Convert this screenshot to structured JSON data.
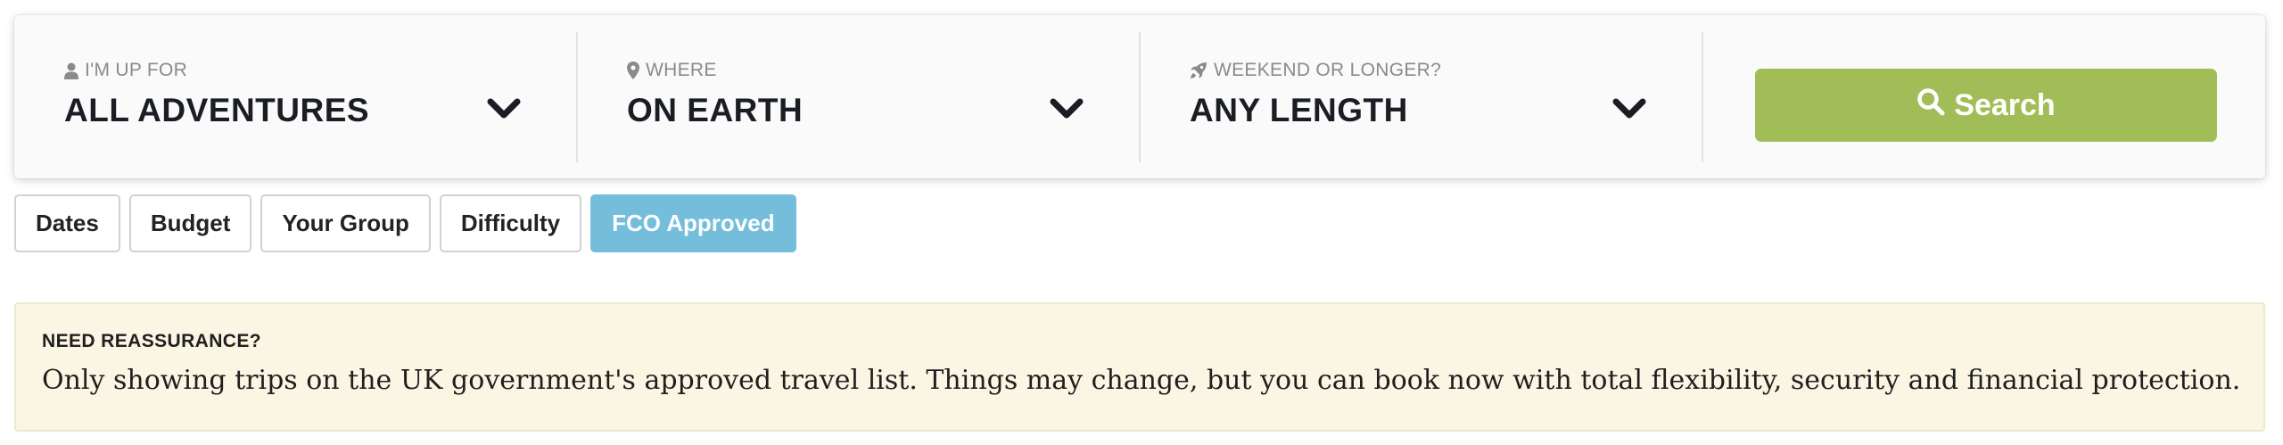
{
  "search_panel": {
    "fields": [
      {
        "label": "I'M UP FOR",
        "value": "ALL ADVENTURES",
        "icon": "person-icon"
      },
      {
        "label": "WHERE",
        "value": "ON EARTH",
        "icon": "map-pin-icon"
      },
      {
        "label": "WEEKEND OR LONGER?",
        "value": "ANY LENGTH",
        "icon": "rocket-icon"
      }
    ],
    "search_button_label": "Search"
  },
  "filters": {
    "items": [
      "Dates",
      "Budget",
      "Your Group",
      "Difficulty",
      "FCO Approved"
    ],
    "active": "FCO Approved"
  },
  "notice": {
    "title": "NEED REASSURANCE?",
    "body": "Only showing trips on the UK government's approved travel list. Things may change, but you can book now with total flexibility, security and financial protection."
  },
  "colors": {
    "accent_green": "#a1bd57",
    "active_filter_blue": "#74bedb",
    "notice_background": "#faf6e3",
    "text_dark": "#1a1e24"
  }
}
